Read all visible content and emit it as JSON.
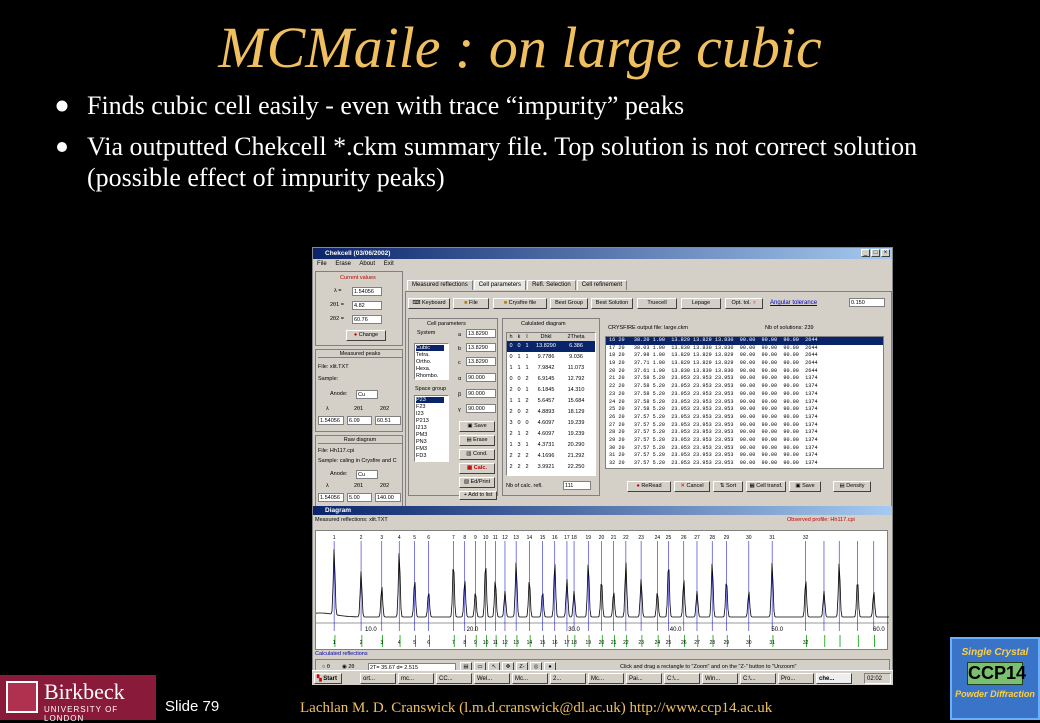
{
  "slide": {
    "title": "MCMaile : on large cubic",
    "bullets": [
      "Finds cubic cell easily - even with trace “impurity” peaks",
      "Via outputted Chekcell *.ckm summary file.  Top solution is not correct solution (possible effect of impurity peaks)"
    ],
    "slide_number": "Slide 79",
    "credit": "Lachlan M. D. Cranswick (l.m.d.cranswick@dl.ac.uk) http://www.ccp14.ac.uk",
    "logo": {
      "name": "Birkbeck",
      "sub": "UNIVERSITY OF LONDON"
    },
    "badge": {
      "top": "Single Crystal",
      "mid": "CCP14",
      "bottom": "Powder Diffraction"
    }
  },
  "window": {
    "title": "Chekcell (03/06/2002)",
    "menu": [
      "File",
      "Erase",
      "About",
      "Exit"
    ],
    "tabs": [
      "Measured reflections",
      "Cell parameters",
      "Refl. Selection",
      "Cell refinement"
    ],
    "current_values": {
      "header": "Current values",
      "lambda": "1.54056",
      "two_theta1": "4.82",
      "two_theta2": "60.76",
      "change_btn": "Change"
    },
    "measured_peaks": {
      "header": "Measured peaks",
      "file": "File: xlit.TXT",
      "sample": "Sample:",
      "anode_label": "Anode:",
      "anode": "Cu",
      "cols": [
        "λ",
        "2θ1",
        "2θ2"
      ],
      "vals": [
        "1.54056",
        "6.09",
        "60.51"
      ]
    },
    "raw_diagram": {
      "header": "Raw diagram",
      "file": "File: Hh117.cpi",
      "sample": "Sample: caling in Crysfire and C",
      "anode_label": "Anode:",
      "anode": "Cu",
      "cols": [
        "λ",
        "2θ1",
        "2θ2"
      ],
      "vals": [
        "1.54056",
        "5.00",
        "140.00"
      ]
    },
    "toolbar": [
      "Keyboard",
      "File",
      "Crysfire file",
      "Best Group",
      "Best Solution",
      "Truecell",
      "Lepage",
      "Opt. tol."
    ],
    "angular_tolerance_label": "Angular tolerance",
    "angular_tolerance": "0.150",
    "cell_params": {
      "header": "Cell parameters",
      "system_label": "System",
      "systems": [
        "Cubic",
        "Tetra.",
        "Ortho.",
        "Hexa.",
        "Rhombo."
      ],
      "params": [
        {
          "name": "a",
          "value": "13.8290"
        },
        {
          "name": "b",
          "value": "13.8290"
        },
        {
          "name": "c",
          "value": "13.8290"
        },
        {
          "name": "α",
          "value": "90.000"
        },
        {
          "name": "β",
          "value": "90.000"
        },
        {
          "name": "γ",
          "value": "90.000"
        }
      ],
      "space_group_label": "Space group",
      "space_groups": [
        "P23",
        "F23",
        "I23",
        "P213",
        "I213",
        "PM3",
        "PN3",
        "FM3",
        "FD3"
      ],
      "buttons": [
        "Save",
        "Erase",
        "Cond.",
        "Calc.",
        "Ed/Print",
        "Add to list"
      ]
    },
    "calc_diagram": {
      "header": "Calulated diagram",
      "cols": [
        "h",
        "k",
        "l",
        "Dhkl",
        "2Theta"
      ],
      "rows": [
        [
          "0",
          "0",
          "1",
          "13.8290",
          "6.386"
        ],
        [
          "0",
          "1",
          "1",
          "9.7786",
          "9.036"
        ],
        [
          "1",
          "1",
          "1",
          "7.9842",
          "11.073"
        ],
        [
          "0",
          "0",
          "2",
          "6.9145",
          "12.792"
        ],
        [
          "2",
          "0",
          "1",
          "6.1845",
          "14.310"
        ],
        [
          "1",
          "1",
          "2",
          "5.6457",
          "15.684"
        ],
        [
          "2",
          "0",
          "2",
          "4.8893",
          "18.129"
        ],
        [
          "3",
          "0",
          "0",
          "4.6097",
          "19.239"
        ],
        [
          "2",
          "1",
          "2",
          "4.6097",
          "19.239"
        ],
        [
          "1",
          "3",
          "1",
          "4.3731",
          "20.290"
        ],
        [
          "2",
          "2",
          "2",
          "4.1696",
          "21.292"
        ],
        [
          "2",
          "2",
          "2",
          "3.9921",
          "22.250"
        ]
      ],
      "nb_label": "Nb of calc. refl.",
      "nb": "111"
    },
    "crysfire": {
      "file_label": "CRYSFIRE output file: large.ckm",
      "nb_solutions": "Nb of solutions: 239",
      "rows": [
        "16 20   38.20 1.00  13.829 13.829 13.830  90.00  90.00  90.00  2644",
        "17 20   38.03 1.00  13.830 13.830 13.830  90.00  90.00  90.00  2644",
        "18 20   37.98 1.00  13.829 13.829 13.829  90.00  90.00  90.00  2644",
        "19 20   37.71 1.00  13.829 13.829 13.829  90.00  90.00  90.00  2644",
        "20 20   37.61 1.00  13.830 13.830 13.830  90.00  90.00  90.00  2644",
        "21 20   37.58 5.20  23.953 23.953 23.953  90.00  90.00  90.00  1374",
        "22 20   37.58 5.20  23.953 23.953 23.953  90.00  90.00  90.00  1374",
        "23 20   37.58 5.20  23.953 23.953 23.953  90.00  90.00  90.00  1374",
        "24 20   37.58 5.20  23.953 23.953 23.953  90.00  90.00  90.00  1374",
        "25 20   37.58 5.20  23.953 23.953 23.953  90.00  90.00  90.00  1374",
        "26 20   37.57 5.20  23.953 23.953 23.953  90.00  90.00  90.00  1374",
        "27 20   37.57 5.20  23.953 23.953 23.953  90.00  90.00  90.00  1374",
        "28 20   37.57 5.20  23.953 23.953 23.953  90.00  90.00  90.00  1374",
        "29 20   37.57 5.20  23.953 23.953 23.953  90.00  90.00  90.00  1374",
        "30 20   37.57 5.20  23.953 23.953 23.953  90.00  90.00  90.00  1374",
        "31 20   37.57 5.20  23.953 23.953 23.953  90.00  90.00  90.00  1374",
        "32 20   37.57 5.20  23.953 23.953 23.953  90.00  90.00  90.00  1374"
      ],
      "buttons": [
        "ReRead",
        "Cancel",
        "Sort",
        "Cell transf.",
        "Save",
        "Density"
      ]
    },
    "diagram": {
      "title": "Diagram",
      "measured": "Measured reflections: xlit.TXT",
      "observed": "Observed profile: Hh117.cpi",
      "calculated": "Calculated reflections",
      "x_ticks": [
        "10.0",
        "20.0",
        "30.0",
        "40.0",
        "50.0",
        "60.0"
      ],
      "peak_labels": [
        "1",
        "2",
        "3",
        "4",
        "5",
        "6",
        "7",
        "8",
        "9",
        "10",
        "11",
        "12",
        "13",
        "14",
        "15",
        "16",
        "17",
        "18",
        "19",
        "20",
        "21",
        "22",
        "23",
        "24",
        "25",
        "26",
        "27",
        "28",
        "29",
        "30",
        "31",
        "32"
      ],
      "status": "2T=  35.67  d=  2.515",
      "hint": "Click and drag a rectangle to \"Zoom\" and on the \"Z-\" button to \"Unzoom\"",
      "opt_theta": "θ",
      "opt_2theta": "2θ"
    },
    "taskbar": {
      "start": "Start",
      "items": [
        "ort...",
        "mc...",
        "CC...",
        "Wel...",
        "Mc...",
        "2...",
        "Mc...",
        "Pai...",
        "C:\\...",
        "Win...",
        "C:\\...",
        "Pro...",
        "che..."
      ],
      "clock": "02:02"
    }
  }
}
